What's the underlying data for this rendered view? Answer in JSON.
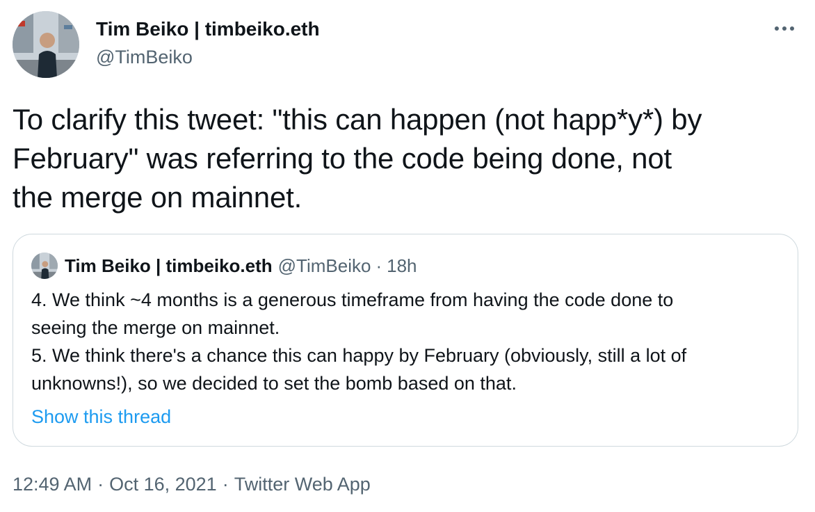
{
  "author": {
    "name": "Tim Beiko | timbeiko.eth",
    "handle": "@TimBeiko"
  },
  "tweet": {
    "text": "To clarify this tweet: \"this can happen (not happ*y*) by\nFebruary\" was referring to the code being done, not\nthe merge on mainnet."
  },
  "quoted_tweet": {
    "name": "Tim Beiko | timbeiko.eth",
    "handle": "@TimBeiko",
    "separator": "·",
    "time": "18h",
    "text": "4. We think ~4 months is a generous timeframe from having the code done to\nseeing the merge on mainnet.\n5. We think there's a chance this can happy by February (obviously, still a lot of\nunknowns!), so we decided to set the bomb based on that.",
    "show_thread_label": "Show this thread"
  },
  "meta": {
    "time": "12:49 AM",
    "separator": "·",
    "date": "Oct 16, 2021",
    "source": "Twitter Web App"
  },
  "icons": {
    "more": "more-horizontal-icon"
  },
  "colors": {
    "text": "#0f1419",
    "secondary": "#536471",
    "link": "#1d9bf0",
    "border": "#cfd9de"
  }
}
